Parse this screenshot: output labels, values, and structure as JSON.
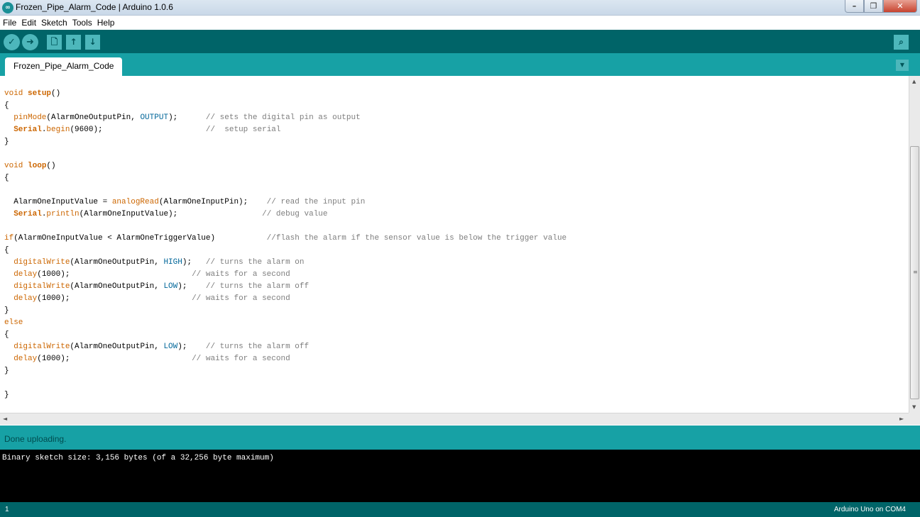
{
  "window": {
    "title": "Frozen_Pipe_Alarm_Code | Arduino 1.0.6",
    "app_icon": "arduino-logo-icon",
    "controls": {
      "minimize": "–",
      "maximize": "❐",
      "close": "✕"
    }
  },
  "menu": {
    "items": [
      "File",
      "Edit",
      "Sketch",
      "Tools",
      "Help"
    ]
  },
  "toolbar": {
    "verify_icon": "✓",
    "upload_icon": "➜",
    "new_icon": "🗋",
    "open_icon": "↑",
    "save_icon": "↓",
    "serial_icon": "⌕",
    "icons": [
      "check-icon",
      "arrow-right-icon",
      "file-icon",
      "arrow-up-icon",
      "arrow-down-icon",
      "magnifier-icon"
    ]
  },
  "tabs": {
    "active": "Frozen_Pipe_Alarm_Code",
    "menu_icon": "▼"
  },
  "editor": {
    "lines": [
      [
        {
          "t": "void ",
          "c": "kt"
        },
        {
          "t": "setup",
          "c": "kwb"
        },
        {
          "t": "()",
          "c": "plain"
        }
      ],
      [
        {
          "t": "{",
          "c": "plain"
        }
      ],
      [
        {
          "t": "  ",
          "c": "plain"
        },
        {
          "t": "pinMode",
          "c": "kw"
        },
        {
          "t": "(AlarmOneOutputPin, ",
          "c": "plain"
        },
        {
          "t": "OUTPUT",
          "c": "const"
        },
        {
          "t": ");      ",
          "c": "plain"
        },
        {
          "t": "// sets the digital pin as output",
          "c": "cm"
        }
      ],
      [
        {
          "t": "  ",
          "c": "plain"
        },
        {
          "t": "Serial",
          "c": "kwb"
        },
        {
          "t": ".",
          "c": "plain"
        },
        {
          "t": "begin",
          "c": "kw"
        },
        {
          "t": "(9600);                      ",
          "c": "plain"
        },
        {
          "t": "//  setup serial",
          "c": "cm"
        }
      ],
      [
        {
          "t": "}",
          "c": "plain"
        }
      ],
      [
        {
          "t": "",
          "c": "plain"
        }
      ],
      [
        {
          "t": "void ",
          "c": "kt"
        },
        {
          "t": "loop",
          "c": "kwb"
        },
        {
          "t": "()",
          "c": "plain"
        }
      ],
      [
        {
          "t": "{",
          "c": "plain"
        }
      ],
      [
        {
          "t": "",
          "c": "plain"
        }
      ],
      [
        {
          "t": "  AlarmOneInputValue = ",
          "c": "plain"
        },
        {
          "t": "analogRead",
          "c": "kw"
        },
        {
          "t": "(AlarmOneInputPin);    ",
          "c": "plain"
        },
        {
          "t": "// read the input pin",
          "c": "cm"
        }
      ],
      [
        {
          "t": "  ",
          "c": "plain"
        },
        {
          "t": "Serial",
          "c": "kwb"
        },
        {
          "t": ".",
          "c": "plain"
        },
        {
          "t": "println",
          "c": "kw"
        },
        {
          "t": "(AlarmOneInputValue);                  ",
          "c": "plain"
        },
        {
          "t": "// debug value",
          "c": "cm"
        }
      ],
      [
        {
          "t": "",
          "c": "plain"
        }
      ],
      [
        {
          "t": "if",
          "c": "kt"
        },
        {
          "t": "(AlarmOneInputValue < AlarmOneTriggerValue)           ",
          "c": "plain"
        },
        {
          "t": "//flash the alarm if the sensor value is below the trigger value",
          "c": "cm"
        }
      ],
      [
        {
          "t": "{",
          "c": "plain"
        }
      ],
      [
        {
          "t": "  ",
          "c": "plain"
        },
        {
          "t": "digitalWrite",
          "c": "kw"
        },
        {
          "t": "(AlarmOneOutputPin, ",
          "c": "plain"
        },
        {
          "t": "HIGH",
          "c": "const"
        },
        {
          "t": ");   ",
          "c": "plain"
        },
        {
          "t": "// turns the alarm on",
          "c": "cm"
        }
      ],
      [
        {
          "t": "  ",
          "c": "plain"
        },
        {
          "t": "delay",
          "c": "kw"
        },
        {
          "t": "(1000);                          ",
          "c": "plain"
        },
        {
          "t": "// waits for a second",
          "c": "cm"
        }
      ],
      [
        {
          "t": "  ",
          "c": "plain"
        },
        {
          "t": "digitalWrite",
          "c": "kw"
        },
        {
          "t": "(AlarmOneOutputPin, ",
          "c": "plain"
        },
        {
          "t": "LOW",
          "c": "const"
        },
        {
          "t": ");    ",
          "c": "plain"
        },
        {
          "t": "// turns the alarm off",
          "c": "cm"
        }
      ],
      [
        {
          "t": "  ",
          "c": "plain"
        },
        {
          "t": "delay",
          "c": "kw"
        },
        {
          "t": "(1000);                          ",
          "c": "plain"
        },
        {
          "t": "// waits for a second",
          "c": "cm"
        }
      ],
      [
        {
          "t": "}",
          "c": "plain"
        }
      ],
      [
        {
          "t": "else",
          "c": "kt"
        }
      ],
      [
        {
          "t": "{",
          "c": "plain"
        }
      ],
      [
        {
          "t": "  ",
          "c": "plain"
        },
        {
          "t": "digitalWrite",
          "c": "kw"
        },
        {
          "t": "(AlarmOneOutputPin, ",
          "c": "plain"
        },
        {
          "t": "LOW",
          "c": "const"
        },
        {
          "t": ");    ",
          "c": "plain"
        },
        {
          "t": "// turns the alarm off",
          "c": "cm"
        }
      ],
      [
        {
          "t": "  ",
          "c": "plain"
        },
        {
          "t": "delay",
          "c": "kw"
        },
        {
          "t": "(1000);                          ",
          "c": "plain"
        },
        {
          "t": "// waits for a second",
          "c": "cm"
        }
      ],
      [
        {
          "t": "}",
          "c": "plain"
        }
      ],
      [
        {
          "t": "",
          "c": "plain"
        }
      ],
      [
        {
          "t": "}",
          "c": "plain"
        }
      ]
    ]
  },
  "scrollbars": {
    "up": "▲",
    "down": "▼",
    "left": "◄",
    "right": "►",
    "grip": "≡"
  },
  "status": {
    "message": "Done uploading."
  },
  "console": {
    "output": "Binary sketch size: 3,156 bytes (of a 32,256 byte maximum)"
  },
  "footer": {
    "line_number": "1",
    "board": "Arduino Uno on COM4"
  },
  "colors": {
    "toolbar": "#006468",
    "tabbar": "#17a1a5",
    "keyword": "#cc6600",
    "constant": "#006699",
    "comment": "#7e7e7e"
  }
}
